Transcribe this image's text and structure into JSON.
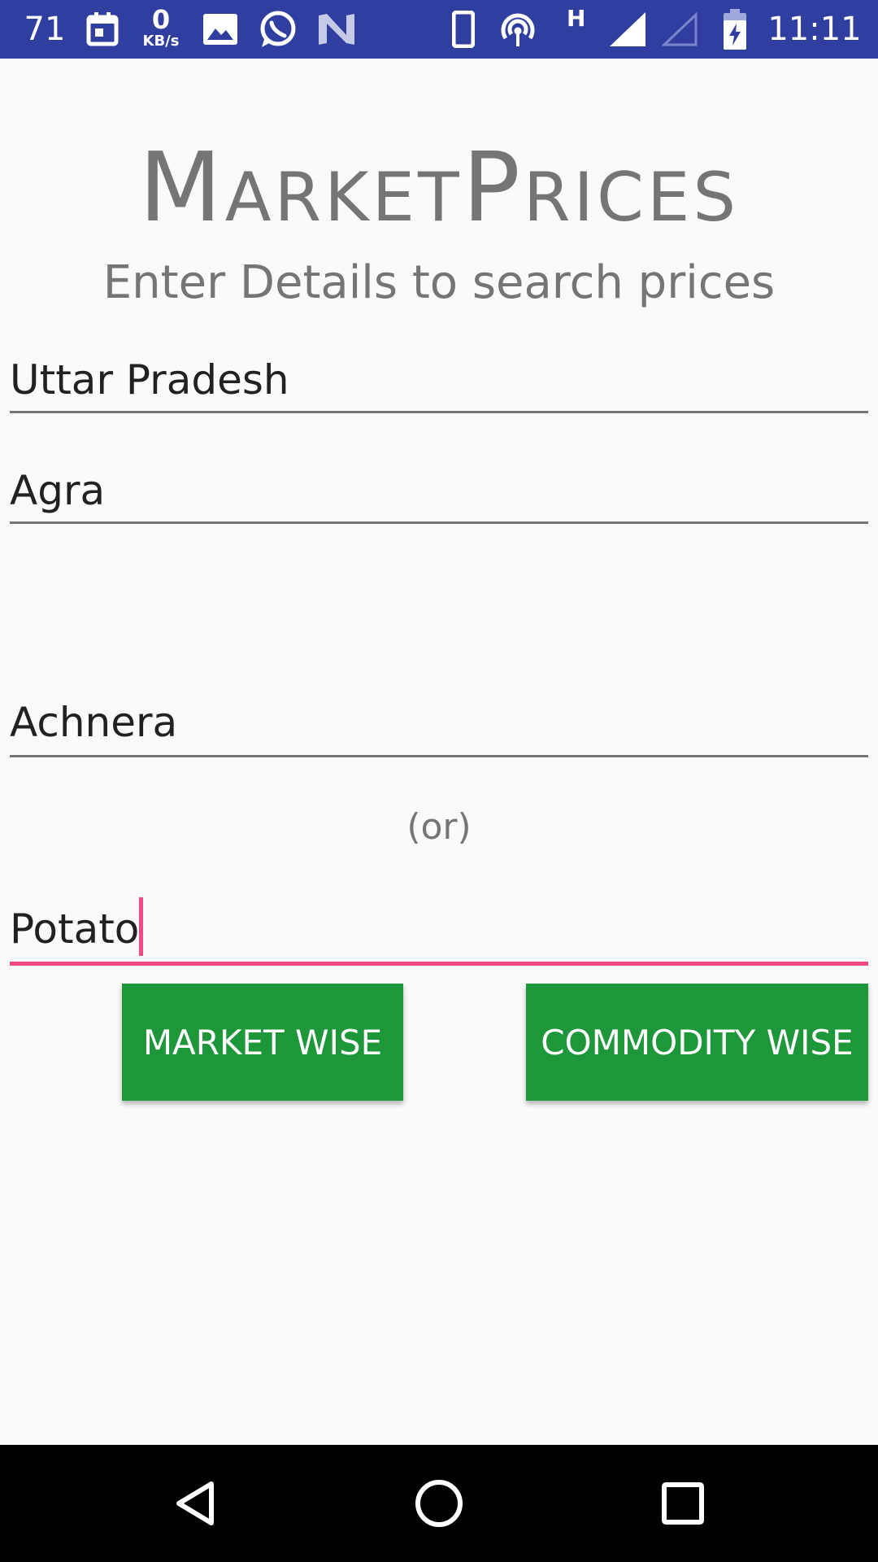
{
  "status_bar": {
    "notification_count": "71",
    "speed_value": "0",
    "speed_unit": "KB/s",
    "network_type": "H",
    "time": "11:11",
    "icons": [
      "calendar-icon",
      "image-icon",
      "whatsapp-icon",
      "n-app-icon",
      "phone-icon",
      "hotspot-icon",
      "signal-icon",
      "signal-empty-icon",
      "battery-charging-icon"
    ]
  },
  "header": {
    "title": "MarketPrices",
    "subtitle": "Enter Details to search prices"
  },
  "form": {
    "state_value": "Uttar Pradesh",
    "district_value": "Agra",
    "market_value": "Achnera",
    "separator": "(or)",
    "commodity_value": "Potato"
  },
  "buttons": {
    "market_wise": "MARKET WISE",
    "commodity_wise": "COMMODITY WISE"
  },
  "colors": {
    "status_bar": "#303f9f",
    "accent": "#ef4a86",
    "button": "#1e963a"
  },
  "nav_bar": {
    "icons": [
      "back-icon",
      "home-icon",
      "recents-icon"
    ]
  }
}
